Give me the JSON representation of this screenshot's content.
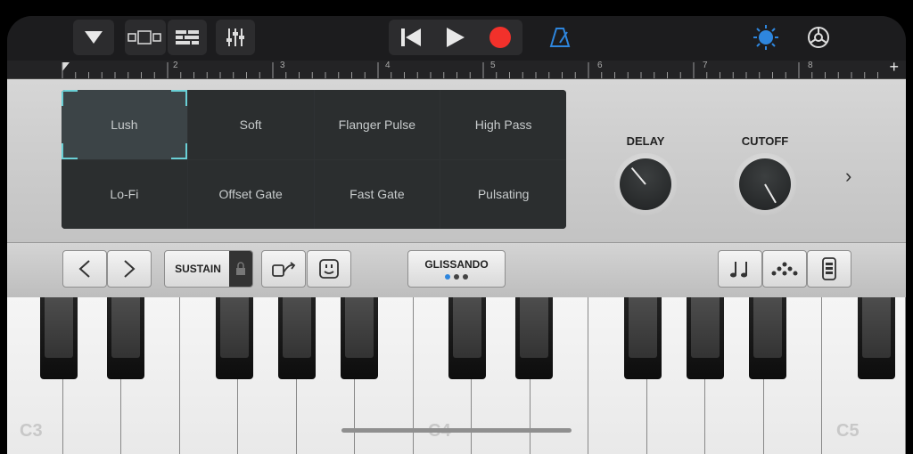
{
  "toolbar": {
    "icons": [
      "navigation-dropdown-icon",
      "tracks-view-icon",
      "mixer-icon",
      "controls-icon",
      "rewind-icon",
      "play-icon",
      "record-icon",
      "metronome-icon",
      "master-effects-icon",
      "settings-icon"
    ],
    "colors": {
      "record": "#f2312b",
      "accent": "#2e86de"
    }
  },
  "ruler": {
    "markers": [
      "2",
      "3",
      "4",
      "5",
      "6",
      "7",
      "8"
    ],
    "add_label": "+"
  },
  "patches": {
    "items": [
      "Lush",
      "Soft",
      "Flanger Pulse",
      "High Pass",
      "Lo-Fi",
      "Offset Gate",
      "Fast Gate",
      "Pulsating"
    ],
    "selected": "Lush"
  },
  "knobs": {
    "delay_label": "DELAY",
    "cutoff_label": "CUTOFF"
  },
  "controls": {
    "sustain_label": "SUSTAIN",
    "glissando_label": "GLISSANDO",
    "glissando_dots_active": 1
  },
  "keyboard": {
    "labels": {
      "c3": "C3",
      "c4": "C4",
      "c5": "C5"
    }
  }
}
